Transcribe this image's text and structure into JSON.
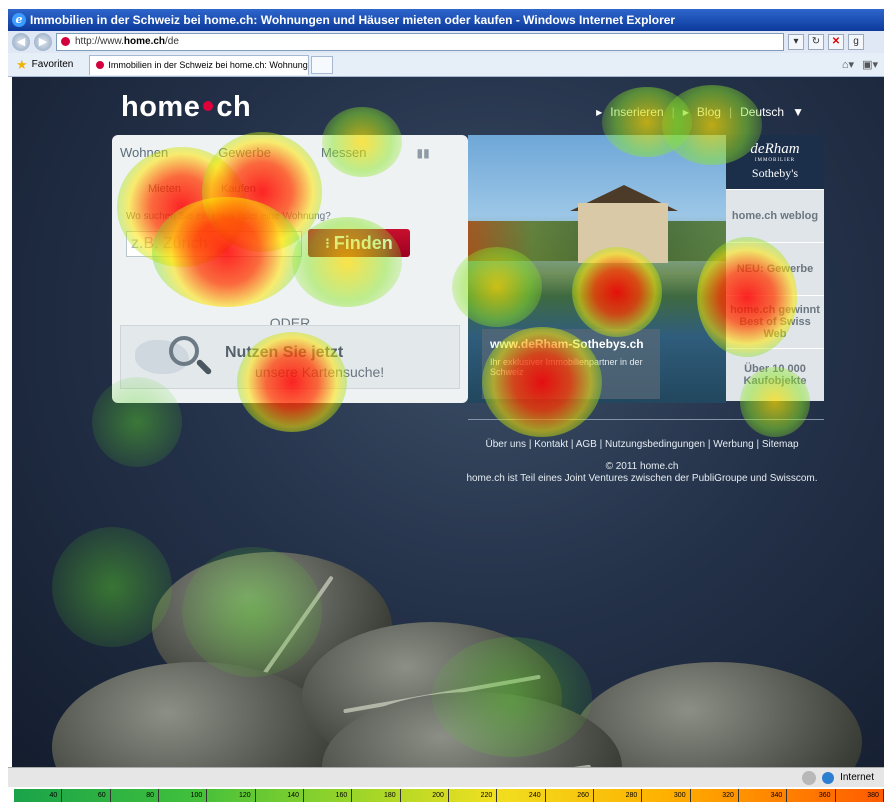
{
  "browser": {
    "title": "Immobilien in der Schweiz bei home.ch: Wohnungen und Häuser mieten oder kaufen - Windows Internet Explorer",
    "url_prefix": "http://www.",
    "url_domain": "home.ch",
    "url_path": "/de",
    "favorites_label": "Favoriten",
    "tab_title": "Immobilien in der Schweiz bei home.ch: Wohnungen u...",
    "zone_label": "Internet"
  },
  "site": {
    "logo_left": "home",
    "logo_right": "ch",
    "nav": {
      "insert": "Inserieren",
      "blog": "Blog",
      "language": "Deutsch"
    }
  },
  "search": {
    "tabs": [
      "Wohnen",
      "Gewerbe",
      "Messen"
    ],
    "subtabs": [
      "Mieten",
      "Kaufen"
    ],
    "question": "Wo suchen Sie ein Haus oder eine Wohnung?",
    "input_placeholder": "z.B. Zürich",
    "find_button": "Finden",
    "or_label": "ODER",
    "map_line1": "Nutzen Sie jetzt",
    "map_line2": "unsere Kartensuche!"
  },
  "promo": {
    "title": "www.deRham-Sothebys.ch",
    "text": "Ihr exklusiver Immobilienpartner in der Schweiz"
  },
  "sidebar": {
    "brand_top": "deRham",
    "brand_sub": "IMMOBILIER",
    "brand_bottom": "Sotheby's",
    "items": [
      "home.ch weblog",
      "NEU: Gewerbe",
      "home.ch gewinnt Best of Swiss Web",
      "Über 10 000 Kaufobjekte"
    ]
  },
  "footer": {
    "links": [
      "Über uns",
      "Kontakt",
      "AGB",
      "Nutzungsbedingungen",
      "Werbung",
      "Sitemap"
    ],
    "copyright": "© 2011 home.ch",
    "note": "home.ch ist Teil eines Joint Ventures zwischen der PubliGroupe und Swisscom."
  },
  "scale_labels": [
    "40",
    "60",
    "80",
    "100",
    "120",
    "140",
    "160",
    "180",
    "200",
    "220",
    "240",
    "260",
    "280",
    "300",
    "320",
    "340",
    "360",
    "380"
  ],
  "colors": {
    "brand_red": "#c8102e",
    "dark_bg": "#24324a",
    "heat_red": "#ff0000",
    "heat_yellow": "#ffe000",
    "heat_green": "#3cc832"
  }
}
